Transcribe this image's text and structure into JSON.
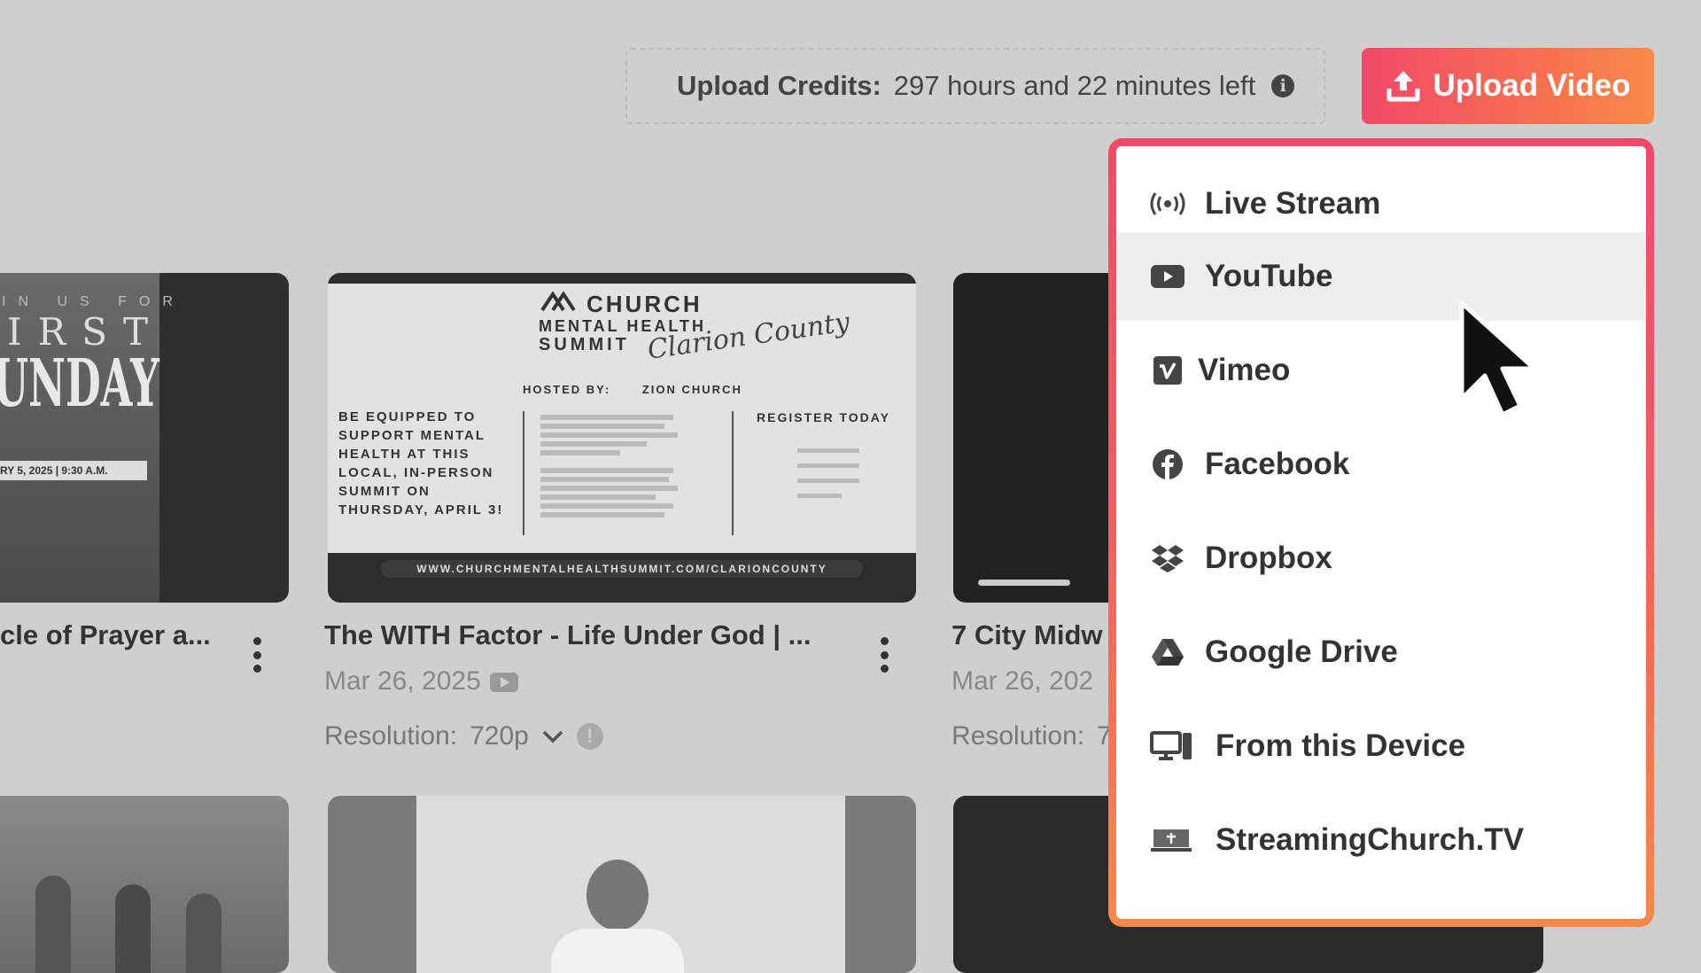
{
  "header": {
    "credits_label": "Upload Credits:",
    "credits_value": "297 hours and 22 minutes left",
    "upload_button": "Upload Video"
  },
  "cards": [
    {
      "title": "cle of Prayer a...",
      "thumb_lines": [
        "IN US FOR",
        "IRST",
        "UNDAY",
        "RY 5, 2025 | 9:30 A.M."
      ]
    },
    {
      "title": "The WITH Factor - Life Under God | ...",
      "date": "Mar 26, 2025",
      "resolution_label": "Resolution:",
      "resolution_value": "720p",
      "poster": {
        "brand": "CHURCH",
        "line2": "MENTAL HEALTH",
        "line3": "SUMMIT",
        "script": "Clarion County",
        "hosted": "HOSTED BY:",
        "host": "ZION CHURCH",
        "left_text": "BE EQUIPPED TO SUPPORT MENTAL HEALTH AT THIS LOCAL, IN-PERSON SUMMIT ON THURSDAY, APRIL 3!",
        "register": "REGISTER TODAY",
        "url": "WWW.CHURCHMENTALHEALTHSUMMIT.COM/CLARIONCOUNTY"
      }
    },
    {
      "title": "7 City Midw",
      "date": "Mar 26, 202",
      "resolution_label": "Resolution:",
      "resolution_value": "7"
    }
  ],
  "menu": {
    "items": [
      {
        "label": "Live Stream",
        "icon": "live-stream-icon"
      },
      {
        "label": "YouTube",
        "icon": "youtube-icon"
      },
      {
        "label": "Vimeo",
        "icon": "vimeo-icon"
      },
      {
        "label": "Facebook",
        "icon": "facebook-icon"
      },
      {
        "label": "Dropbox",
        "icon": "dropbox-icon"
      },
      {
        "label": "Google Drive",
        "icon": "google-drive-icon"
      },
      {
        "label": "From this Device",
        "icon": "device-icon"
      },
      {
        "label": "StreamingChurch.TV",
        "icon": "streamingchurch-icon"
      }
    ],
    "hovered_index": 1
  },
  "colors": {
    "accent_start": "#f2496a",
    "accent_end": "#f9894a",
    "background": "#cfcfcf"
  }
}
